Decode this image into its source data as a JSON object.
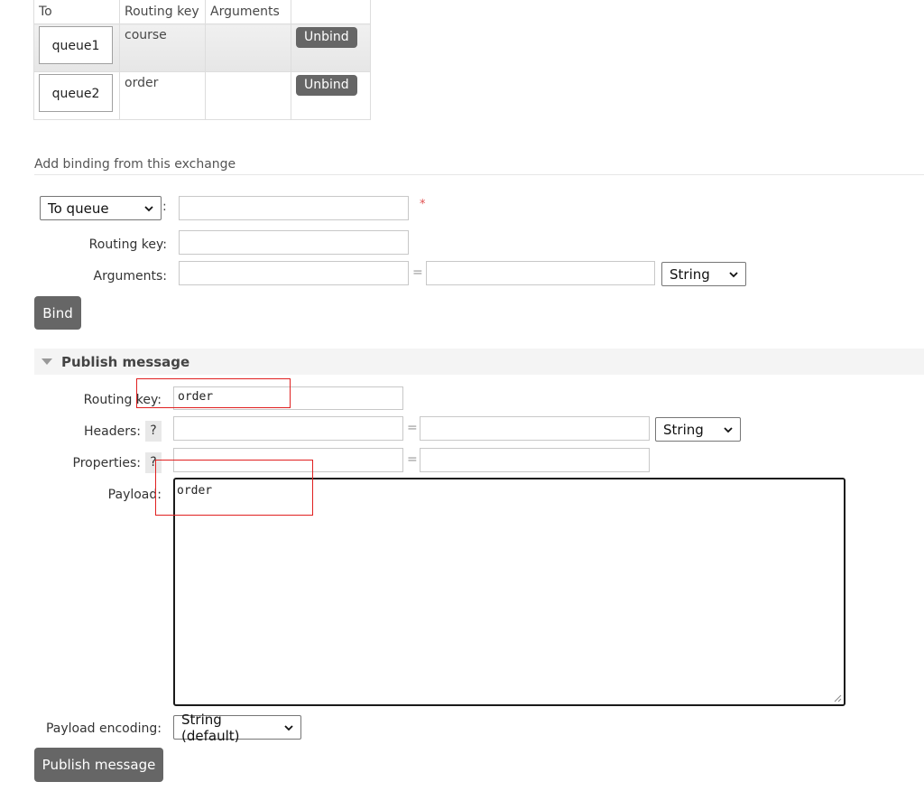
{
  "bindings_table": {
    "headers": [
      "To",
      "Routing key",
      "Arguments",
      ""
    ],
    "rows": [
      {
        "to": "queue1",
        "routing_key": "course",
        "arguments": "",
        "action": "Unbind"
      },
      {
        "to": "queue2",
        "routing_key": "order",
        "arguments": "",
        "action": "Unbind"
      }
    ]
  },
  "add_binding": {
    "section_title": "Add binding from this exchange",
    "destination_type": "To queue",
    "colon": ":",
    "required_mark": "*",
    "routing_key_label": "Routing key:",
    "arguments_label": "Arguments:",
    "equals": "=",
    "arg_type": "String",
    "bind_button": "Bind"
  },
  "publish": {
    "section_title": "Publish message",
    "routing_key_label": "Routing key:",
    "routing_key_value": "order",
    "headers_label": "Headers:",
    "properties_label": "Properties:",
    "help_mark": "?",
    "equals": "=",
    "header_type": "String",
    "payload_label": "Payload:",
    "payload_value": "order",
    "encoding_label": "Payload encoding:",
    "encoding_value": "String (default)",
    "publish_button": "Publish message"
  },
  "colors": {
    "button_bg": "#666666",
    "annotation_red": "#e02020",
    "required_star": "#e05050"
  }
}
